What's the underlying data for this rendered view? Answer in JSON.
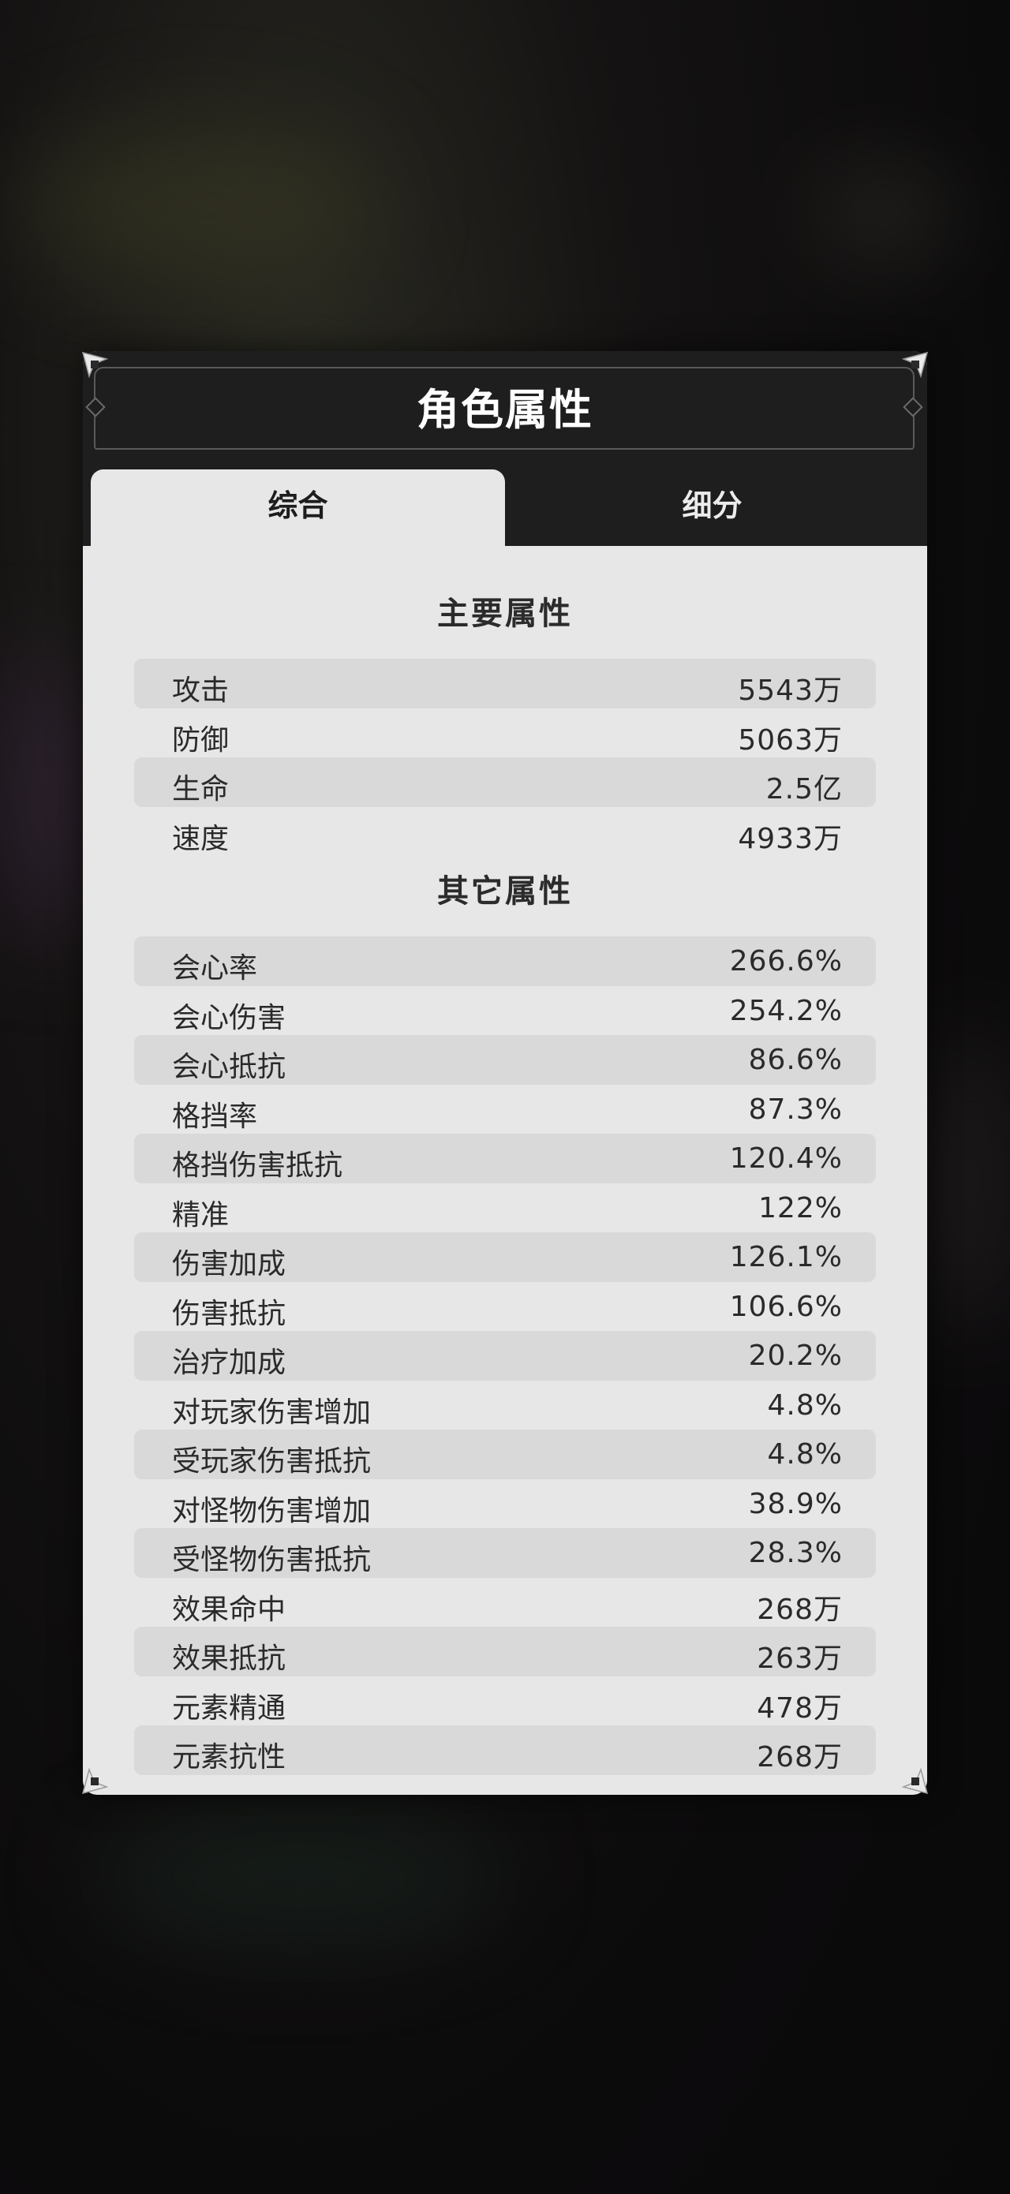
{
  "panel": {
    "title": "角色属性",
    "tabs": [
      {
        "label": "综合",
        "active": true
      },
      {
        "label": "细分",
        "active": false
      }
    ]
  },
  "main_stats": {
    "title": "主要属性",
    "items": [
      {
        "label": "攻击",
        "value": "5543万"
      },
      {
        "label": "防御",
        "value": "5063万"
      },
      {
        "label": "生命",
        "value": "2.5亿"
      },
      {
        "label": "速度",
        "value": "4933万"
      }
    ]
  },
  "other_stats": {
    "title": "其它属性",
    "items": [
      {
        "label": "会心率",
        "value": "266.6%"
      },
      {
        "label": "会心伤害",
        "value": "254.2%"
      },
      {
        "label": "会心抵抗",
        "value": "86.6%"
      },
      {
        "label": "格挡率",
        "value": "87.3%"
      },
      {
        "label": "格挡伤害抵抗",
        "value": "120.4%"
      },
      {
        "label": "精准",
        "value": "122%"
      },
      {
        "label": "伤害加成",
        "value": "126.1%"
      },
      {
        "label": "伤害抵抗",
        "value": "106.6%"
      },
      {
        "label": "治疗加成",
        "value": "20.2%"
      },
      {
        "label": "对玩家伤害增加",
        "value": "4.8%"
      },
      {
        "label": "受玩家伤害抵抗",
        "value": "4.8%"
      },
      {
        "label": "对怪物伤害增加",
        "value": "38.9%"
      },
      {
        "label": "受怪物伤害抵抗",
        "value": "28.3%"
      },
      {
        "label": "效果命中",
        "value": "268万"
      },
      {
        "label": "效果抵抗",
        "value": "263万"
      },
      {
        "label": "元素精通",
        "value": "478万"
      },
      {
        "label": "元素抗性",
        "value": "268万"
      }
    ]
  },
  "colors": {
    "panel_bg": "#e7e7e7",
    "header_bg": "#1f1e1f",
    "row_shade": "#d9d9d9",
    "text": "#2a2a2a"
  },
  "icons": [
    "corner-ornament-icon"
  ]
}
